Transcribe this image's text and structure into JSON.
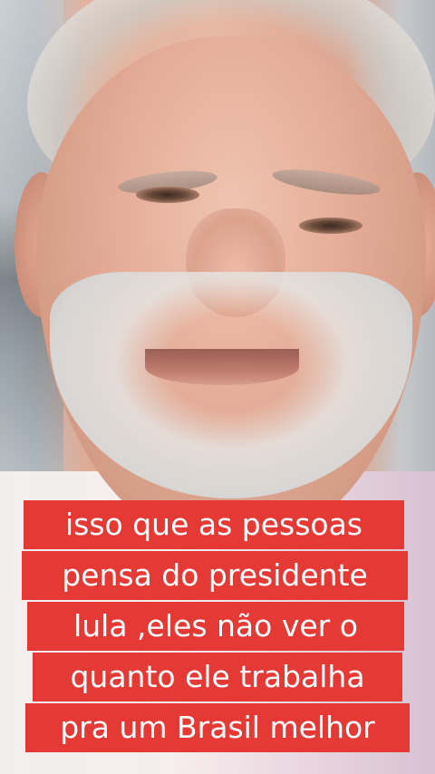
{
  "caption": {
    "lines": [
      "isso que as pessoas",
      "pensa do presidente",
      "lula ,eles não ver o",
      "quanto ele trabalha",
      "pra um Brasil melhor"
    ],
    "background_color": "#e53935",
    "text_color": "#ffffff"
  }
}
